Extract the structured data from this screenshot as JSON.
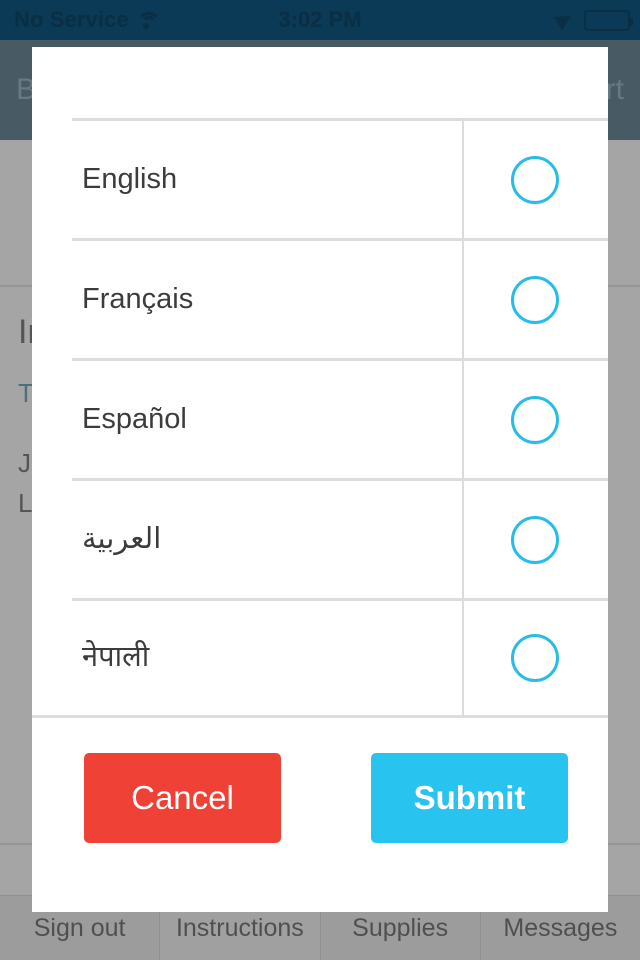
{
  "status_bar": {
    "carrier": "No Service",
    "wifi_icon": "wifi-icon",
    "time": "3:02 PM",
    "location_icon": "location-arrow-icon",
    "battery_icon": "battery-full-icon"
  },
  "app": {
    "navbar": {
      "back_label": "Back",
      "right_label": "Cart"
    },
    "content": {
      "heading": "Instructions",
      "link": "Tap here for more info",
      "paragraph_line_1": "Je suis un patient",
      "paragraph_line_2": "Language preference"
    },
    "tabs": [
      {
        "label": "Sign out",
        "active": false
      },
      {
        "label": "Instructions",
        "active": true
      },
      {
        "label": "Supplies",
        "active": false
      },
      {
        "label": "Messages",
        "active": false
      }
    ]
  },
  "modal": {
    "languages": [
      {
        "label": "English",
        "rtl": false,
        "selected": false
      },
      {
        "label": "Français",
        "rtl": false,
        "selected": false
      },
      {
        "label": "Español",
        "rtl": false,
        "selected": false
      },
      {
        "label": "العربية",
        "rtl": true,
        "selected": false
      },
      {
        "label": "नेपाली",
        "rtl": false,
        "selected": false
      }
    ],
    "cancel_label": "Cancel",
    "submit_label": "Submit"
  },
  "colors": {
    "status_bar_bg": "#0b3a56",
    "navbar_bg": "#0b3a56",
    "accent_cyan": "#29bce6",
    "submit_blue": "#29c3ef",
    "cancel_red": "#ef4136",
    "divider": "#dddddd",
    "overlay": "#6e6e6e",
    "label_text": "#3c3c3c",
    "link_text": "#1a6e8e"
  }
}
